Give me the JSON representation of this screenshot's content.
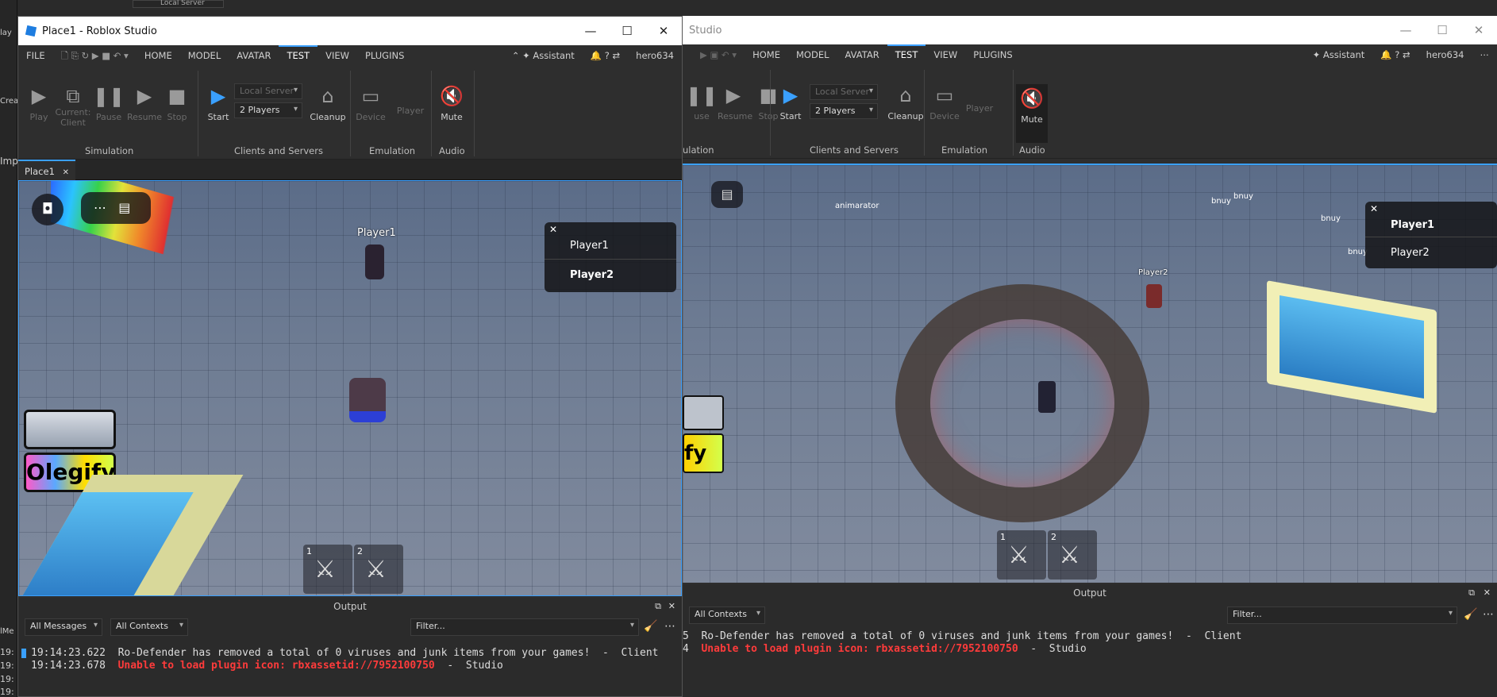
{
  "app_title": "Place1 - Roblox Studio",
  "right_title": "Studio",
  "menu": {
    "file": "FILE",
    "home": "HOME",
    "model": "MODEL",
    "avatar": "AVATAR",
    "test": "TEST",
    "view": "VIEW",
    "plugins": "PLUGINS",
    "assistant": "Assistant",
    "user": "hero634"
  },
  "ribbon": {
    "play": "Play",
    "current_client": "Current:",
    "current_client2": "Client",
    "pause": "Pause",
    "resume": "Resume",
    "stop": "Stop",
    "start": "Start",
    "server_select": "Local Server",
    "players_select": "2 Players",
    "cleanup": "Cleanup",
    "device": "Device",
    "player": "Player",
    "mute": "Mute",
    "grp_simulation": "Simulation",
    "grp_clients": "Clients and Servers",
    "grp_emulation": "Emulation",
    "grp_audio": "Audio",
    "grp_simulation_cut": "ulation",
    "pause_cut": "use"
  },
  "tab": {
    "label": "Place1",
    "close": "✕"
  },
  "left_view": {
    "player_list": [
      "Player1",
      "Player2"
    ],
    "name_tag": "Player1",
    "olegify": "Olegify",
    "hotbar": [
      "1",
      "2"
    ]
  },
  "right_view": {
    "player_list": [
      "Player1",
      "Player2"
    ],
    "name_tag": "Player2",
    "labels": [
      "animarator",
      "bnuy",
      "bnuy",
      "bnuy",
      "bnuy"
    ],
    "olegify_cut": "fy",
    "hotbar": [
      "1",
      "2"
    ]
  },
  "output": {
    "title": "Output",
    "filter_messages": "All Messages",
    "filter_contexts": "All Contexts",
    "filter_placeholder": "Filter...",
    "lines": [
      {
        "time": "19:14:23.622",
        "text": "Ro-Defender has removed a total of 0 viruses and junk items from your games!",
        "ctx": "  -  Client"
      },
      {
        "time": "19:14:23.678",
        "text": "Unable to load plugin icon: rbxassetid://7952100750",
        "ctx": "  -  Studio"
      }
    ],
    "right_prefix": [
      "5",
      "4"
    ]
  },
  "desktop": {
    "server": "Local Server",
    "left_labels": [
      "lay",
      "Crea",
      "Imp",
      "lMe",
      "19:",
      "19:",
      "19:",
      "19:"
    ]
  },
  "colors": {
    "accent": "#3aa0ff",
    "error": "#ff3b3b"
  }
}
